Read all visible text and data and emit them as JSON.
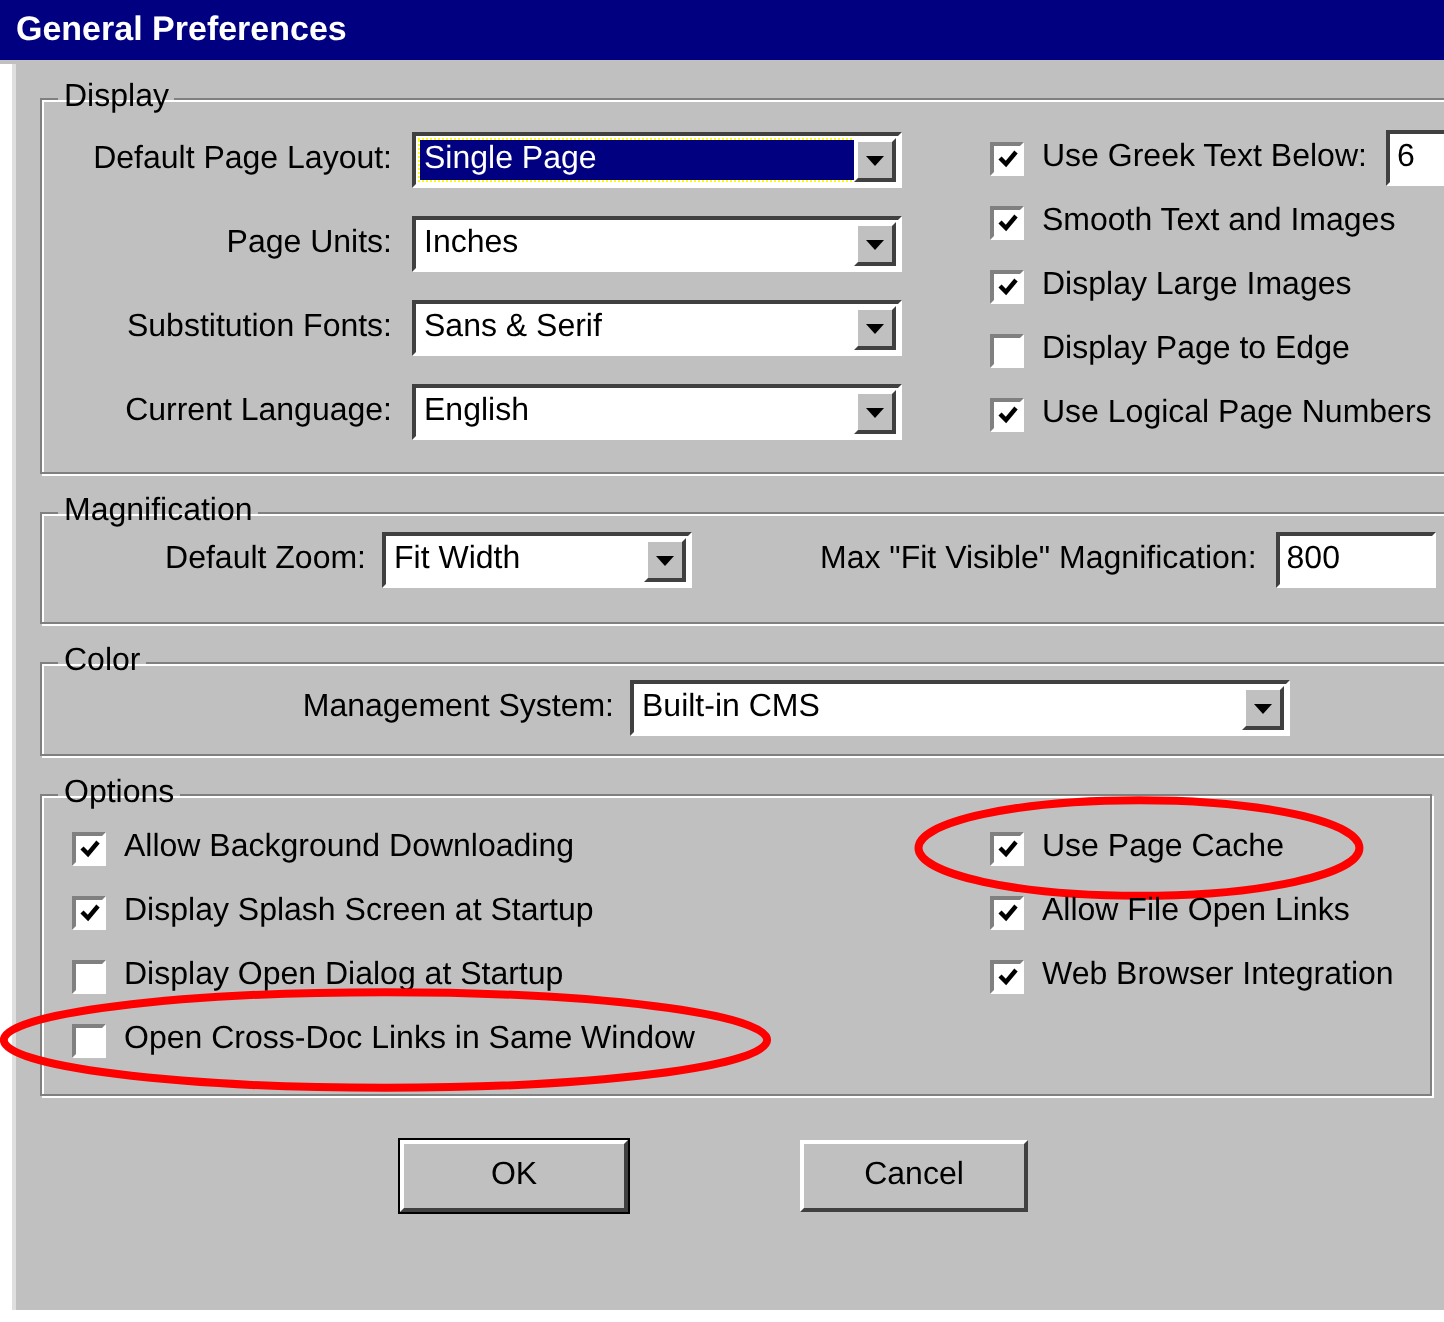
{
  "window": {
    "title": "General Preferences"
  },
  "display": {
    "legend": "Display",
    "dropdowns": [
      {
        "label": "Default Page Layout:",
        "value": "Single Page",
        "focused": true
      },
      {
        "label": "Page Units:",
        "value": "Inches",
        "focused": false
      },
      {
        "label": "Substitution Fonts:",
        "value": "Sans & Serif",
        "focused": false
      },
      {
        "label": "Current Language:",
        "value": "English",
        "focused": false
      }
    ],
    "checkboxes": [
      {
        "kind": "with_field",
        "label": "Use Greek Text Below:",
        "checked": true,
        "field_value": "6"
      },
      {
        "kind": "plain",
        "label": "Smooth Text and Images",
        "checked": true
      },
      {
        "kind": "plain",
        "label": "Display Large Images",
        "checked": true
      },
      {
        "kind": "plain",
        "label": "Display Page to Edge",
        "checked": false
      },
      {
        "kind": "plain",
        "label": "Use Logical Page Numbers",
        "checked": true
      }
    ]
  },
  "magnification": {
    "legend": "Magnification",
    "zoom": {
      "label": "Default Zoom:",
      "value": "Fit Width"
    },
    "max_fit_visible": {
      "label": "Max \"Fit Visible\" Magnification:",
      "value": "800"
    }
  },
  "color": {
    "legend": "Color",
    "management_system": {
      "label": "Management System:",
      "value": "Built-in CMS"
    }
  },
  "options": {
    "legend": "Options",
    "left": [
      {
        "label": "Allow Background Downloading",
        "checked": true,
        "circled": false
      },
      {
        "label": "Display Splash Screen at Startup",
        "checked": true,
        "circled": false
      },
      {
        "label": "Display Open Dialog at Startup",
        "checked": false,
        "circled": false
      },
      {
        "label": "Open Cross-Doc Links in Same Window",
        "checked": false,
        "circled": true
      }
    ],
    "right": [
      {
        "label": "Use Page Cache",
        "checked": true,
        "circled": true
      },
      {
        "label": "Allow File Open Links",
        "checked": true,
        "circled": false
      },
      {
        "label": "Web Browser Integration",
        "checked": true,
        "circled": false
      }
    ]
  },
  "buttons": [
    {
      "label": "OK",
      "default": true
    },
    {
      "label": "Cancel",
      "default": false
    }
  ]
}
